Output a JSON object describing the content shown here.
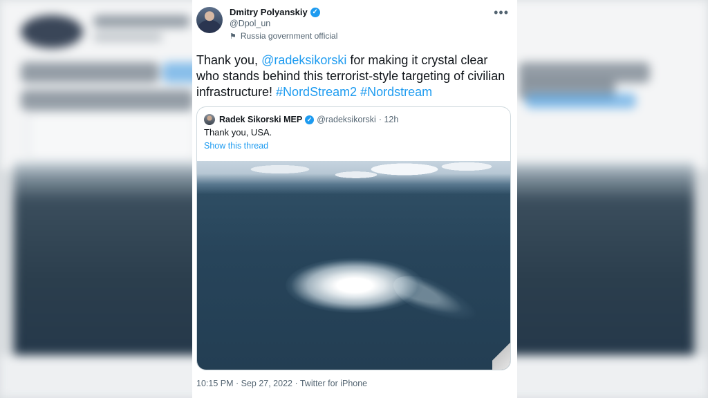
{
  "author": {
    "name": "Dmitry Polyanskiy",
    "handle": "@Dpol_un",
    "label": "Russia government official"
  },
  "tweet": {
    "text_prefix": "Thank you, ",
    "mention": "@radeksikorski",
    "text_middle": " for making it crystal clear who stands behind this terrorist-style targeting of civilian infrastructure! ",
    "hashtag1": "#NordStream2",
    "hashtag2": "#Nordstream",
    "meta": "10:15 PM · Sep 27, 2022 · Twitter for iPhone"
  },
  "quoted": {
    "name": "Radek Sikorski MEP",
    "handle": "@radeksikorski",
    "time": "· 12h",
    "text": "Thank you, USA.",
    "thread_link": "Show this thread"
  },
  "icons": {
    "verified": "verified-badge-icon",
    "label": "flag-icon",
    "more": "more-options-icon"
  },
  "colors": {
    "accent": "#1d9bf0",
    "text": "#0f1419",
    "secondary": "#536471"
  }
}
